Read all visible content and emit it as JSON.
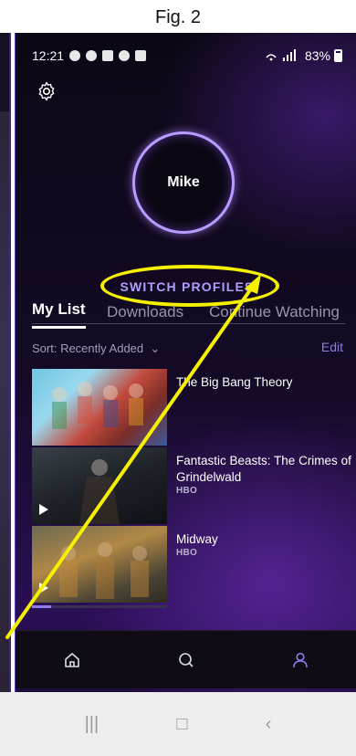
{
  "figure": {
    "caption": "Fig. 2"
  },
  "statusbar": {
    "time": "12:21",
    "battery": "83%"
  },
  "profile": {
    "name": "Mike",
    "switch_label": "SWITCH PROFILES"
  },
  "tabs": [
    {
      "label": "My List",
      "active": true
    },
    {
      "label": "Downloads",
      "active": false
    },
    {
      "label": "Continue Watching",
      "active": false
    }
  ],
  "sort": {
    "label": "Sort: Recently Added"
  },
  "edit_label": "Edit",
  "list": [
    {
      "title": "The Big Bang Theory",
      "subtitle": "",
      "progress": 0
    },
    {
      "title": "Fantastic Beasts: The Crimes of Grindelwald",
      "subtitle": "HBO",
      "progress": 0.0
    },
    {
      "title": "Midway",
      "subtitle": "HBO",
      "progress": 0.14
    }
  ],
  "bottom_nav": [
    {
      "icon": "home-icon",
      "active": false
    },
    {
      "icon": "search-icon",
      "active": false
    },
    {
      "icon": "profile-icon",
      "active": true
    }
  ],
  "colors": {
    "accent": "#b29cff",
    "highlight": "#f5f000",
    "active_nav": "#8f7cf0"
  }
}
